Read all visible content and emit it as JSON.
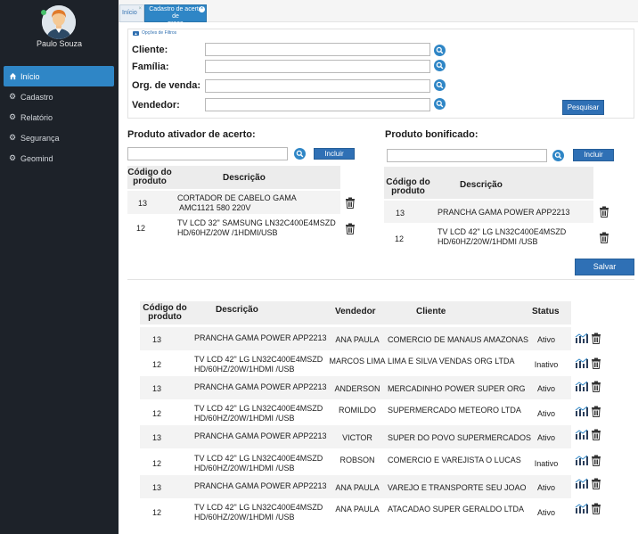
{
  "user": {
    "name": "Paulo Souza"
  },
  "sidebar": {
    "items": [
      {
        "label": "Início",
        "icon": "home-icon"
      },
      {
        "label": "Cadastro",
        "icon": "gears-icon"
      },
      {
        "label": "Relatório",
        "icon": "gears-icon"
      },
      {
        "label": "Segurança",
        "icon": "gears-icon"
      },
      {
        "label": "Geomind",
        "icon": "gears-icon"
      }
    ]
  },
  "tabs": {
    "home": "Início",
    "active_line1": "Cadastro de acerto de",
    "active_line2": "preço"
  },
  "filters": {
    "toggle_label": "Opções de Filtros",
    "cliente": "Cliente:",
    "familia": "Família:",
    "org_venda": "Org. de venda:",
    "vendedor": "Vendedor:",
    "search_button": "Pesquisar"
  },
  "ativador": {
    "title": "Produto ativador de acerto:",
    "include_button": "Incluir",
    "col_code_1": "Código do",
    "col_code_2": "produto",
    "col_desc": "Descrição",
    "rows": [
      {
        "code": "13",
        "desc1": "CORTADOR DE CABELO GAMA",
        "desc2": "AMC1121 580 220V"
      },
      {
        "code": "12",
        "desc1": "TV LCD 32\" SAMSUNG LN32C400E4MSZD",
        "desc2": "HD/60HZ/20W /1HDMI/USB"
      }
    ]
  },
  "bonificado": {
    "title": "Produto bonificado:",
    "include_button": "Incluir",
    "col_code_1": "Código do",
    "col_code_2": "produto",
    "col_desc": "Descrição",
    "rows": [
      {
        "code": "13",
        "desc1": "PRANCHA GAMA POWER APP2213",
        "desc2": ""
      },
      {
        "code": "12",
        "desc1": "TV LCD 42\" LG LN32C400E4MSZD",
        "desc2": "HD/60HZ/20W/1HDMI /USB"
      }
    ]
  },
  "save_button": "Salvar",
  "results": {
    "headers": {
      "code1": "Código do",
      "code2": "produto",
      "desc": "Descrição",
      "vendedor": "Vendedor",
      "cliente": "Cliente",
      "status": "Status"
    },
    "rows": [
      {
        "code": "13",
        "desc1": "PRANCHA GAMA POWER APP2213",
        "desc2": "",
        "vendedor": "ANA PAULA",
        "cliente": "COMERCIO DE MANAUS AMAZONAS",
        "status": "Ativo"
      },
      {
        "code": "12",
        "desc1": "TV LCD 42\" LG LN32C400E4MSZD",
        "desc2": "HD/60HZ/20W/1HDMI /USB",
        "vendedor": "MARCOS LIMA",
        "cliente": "LIMA E SILVA VENDAS ORG LTDA",
        "status": "Inativo"
      },
      {
        "code": "13",
        "desc1": "PRANCHA GAMA POWER APP2213",
        "desc2": "",
        "vendedor": "ANDERSON",
        "cliente": "MERCADINHO POWER SUPER ORG",
        "status": "Ativo"
      },
      {
        "code": "12",
        "desc1": "TV LCD 42\" LG LN32C400E4MSZD",
        "desc2": "HD/60HZ/20W/1HDMI /USB",
        "vendedor": "ROMILDO",
        "cliente": "SUPERMERCADO METEORO LTDA",
        "status": "Ativo"
      },
      {
        "code": "13",
        "desc1": "PRANCHA GAMA POWER APP2213",
        "desc2": "",
        "vendedor": "VICTOR",
        "cliente": "SUPER DO POVO SUPERMERCADOS",
        "status": "Ativo"
      },
      {
        "code": "12",
        "desc1": "TV LCD 42\" LG LN32C400E4MSZD",
        "desc2": "HD/60HZ/20W/1HDMI /USB",
        "vendedor": "ROBSON",
        "cliente": "COMERCIO E VAREJISTA O LUCAS",
        "status": "Inativo"
      },
      {
        "code": "13",
        "desc1": "PRANCHA GAMA POWER APP2213",
        "desc2": "",
        "vendedor": "ANA PAULA",
        "cliente": "VAREJO E TRANSPORTE SEU JOAO",
        "status": "Ativo"
      },
      {
        "code": "12",
        "desc1": "TV LCD 42\" LG LN32C400E4MSZD",
        "desc2": "HD/60HZ/20W/1HDMI /USB",
        "vendedor": "ANA PAULA",
        "cliente": "ATACADAO SUPER GERALDO LTDA",
        "status": "Ativo"
      }
    ]
  },
  "colors": {
    "sidebar_bg": "#1d2229",
    "accent": "#2f86c6",
    "button": "#2f70b5"
  }
}
